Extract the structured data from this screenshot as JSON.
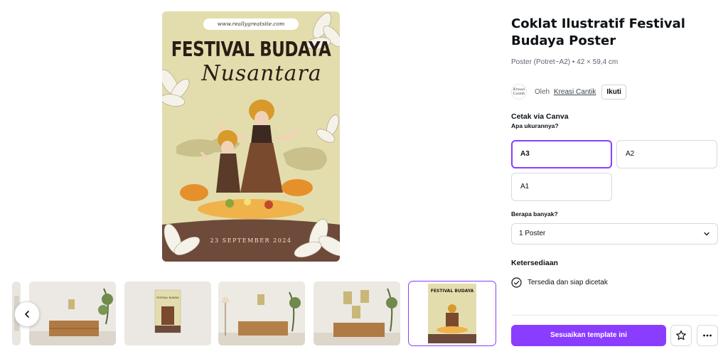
{
  "preview": {
    "url": "www.reallygreatsite.com",
    "headline": "FESTIVAL BUDAYA",
    "script_word": "Nusantara",
    "date": "23 SEPTEMBER 2024"
  },
  "thumbnails": [
    {
      "label": "room-living-poster"
    },
    {
      "label": "poster-wall-frame"
    },
    {
      "label": "room-console-poster"
    },
    {
      "label": "room-sideboard-posters"
    },
    {
      "label": "poster-flat",
      "selected": true
    }
  ],
  "product": {
    "title": "Coklat Ilustratif Festival Budaya Poster",
    "subtitle": "Poster (Potret−A2) • 42 × 59,4 cm",
    "author_logo_text": "Kreasi Cantik",
    "by_label": "Oleh",
    "author_name": "Kreasi Cantik",
    "follow_label": "Ikuti"
  },
  "print": {
    "heading": "Cetak via Canva",
    "size_question": "Apa ukurannya?",
    "sizes": [
      {
        "label": "A3",
        "selected": true
      },
      {
        "label": "A2",
        "selected": false
      },
      {
        "label": "A1",
        "selected": false
      }
    ],
    "qty_question": "Berapa banyak?",
    "qty_value": "1 Poster"
  },
  "availability": {
    "heading": "Ketersediaan",
    "status": "Tersedia dan siap dicetak"
  },
  "actions": {
    "cta_label": "Sesuaikan template ini"
  },
  "colors": {
    "accent": "#8b3dff",
    "poster_bg": "#e3ddae",
    "poster_brown": "#6e4a3a"
  }
}
